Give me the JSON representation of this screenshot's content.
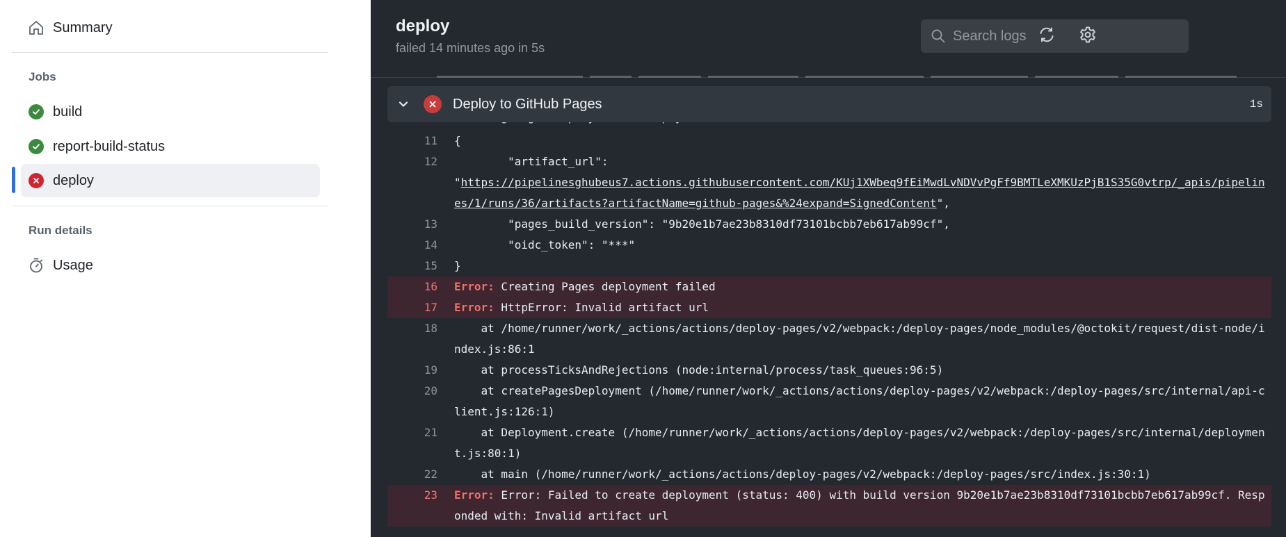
{
  "sidebar": {
    "summary_label": "Summary",
    "jobs_title": "Jobs",
    "jobs": [
      {
        "label": "build",
        "status": "success"
      },
      {
        "label": "report-build-status",
        "status": "success"
      },
      {
        "label": "deploy",
        "status": "failure"
      }
    ],
    "run_details_title": "Run details",
    "usage_label": "Usage"
  },
  "header": {
    "title": "deploy",
    "status_text": "failed 14 minutes ago in 5s",
    "search_placeholder": "Search logs"
  },
  "step": {
    "title": "Deploy to GitHub Pages",
    "duration": "1s",
    "status": "failure"
  },
  "log": {
    "partial_line_text": "Creating Pages deployment with payload:",
    "lines": [
      {
        "n": "11",
        "text": "{"
      },
      {
        "n": "12",
        "text": "        \"artifact_url\":",
        "url_pre": "\"",
        "url": "https://pipelinesghubeus7.actions.githubusercontent.com/KUj1XWbeq9fEiMwdLvNDVvPgFf9BMTLeXMKUzPjB1S35G0vtrp/_apis/pipelines/1/runs/36/artifacts?artifactName=github-pages&%24expand=SignedContent",
        "url_post": "\","
      },
      {
        "n": "13",
        "text": "        \"pages_build_version\": \"9b20e1b7ae23b8310df73101bcbb7eb617ab99cf\","
      },
      {
        "n": "14",
        "text": "        \"oidc_token\": \"***\""
      },
      {
        "n": "15",
        "text": "}"
      },
      {
        "n": "16",
        "kw": "Error:",
        "text": " Creating Pages deployment failed"
      },
      {
        "n": "17",
        "kw": "Error:",
        "text": " HttpError: Invalid artifact url"
      },
      {
        "n": "18",
        "text": "    at /home/runner/work/_actions/actions/deploy-pages/v2/webpack:/deploy-pages/node_modules/@octokit/request/dist-node/index.js:86:1"
      },
      {
        "n": "19",
        "text": "    at processTicksAndRejections (node:internal/process/task_queues:96:5)"
      },
      {
        "n": "20",
        "text": "    at createPagesDeployment (/home/runner/work/_actions/actions/deploy-pages/v2/webpack:/deploy-pages/src/internal/api-client.js:126:1)"
      },
      {
        "n": "21",
        "text": "    at Deployment.create (/home/runner/work/_actions/actions/deploy-pages/v2/webpack:/deploy-pages/src/internal/deployment.js:80:1)"
      },
      {
        "n": "22",
        "text": "    at main (/home/runner/work/_actions/actions/deploy-pages/v2/webpack:/deploy-pages/src/index.js:30:1)"
      },
      {
        "n": "23",
        "kw": "Error:",
        "text": " Error: Failed to create deployment (status: 400) with build version 9b20e1b7ae23b8310df73101bcbb7eb617ab99cf. Responded with: Invalid artifact url"
      }
    ]
  },
  "colors": {
    "success": "#3c8a3f",
    "failure": "#d1242f",
    "log_bg": "#24292f",
    "error_row_bg": "#3d2630",
    "active_indicator": "#2f6fdc"
  }
}
